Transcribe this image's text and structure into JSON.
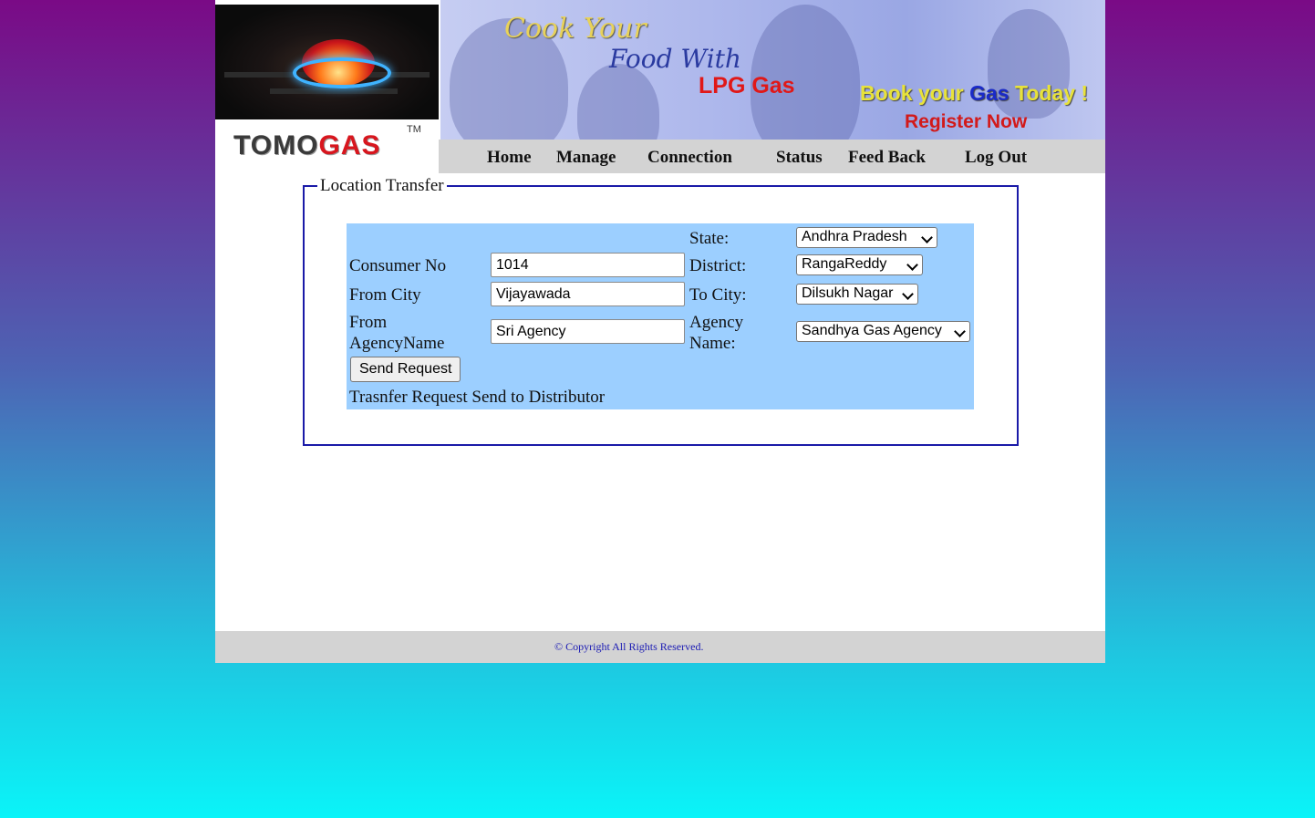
{
  "brand": {
    "logo_text_left": "TOMO",
    "logo_text_right": "GAS",
    "trademark": "TM"
  },
  "banner": {
    "line1": "Cook Your",
    "line2": "Food With",
    "line3": "LPG Gas",
    "book_part1": "Book your ",
    "book_gas": "Gas",
    "book_part2": " Today !",
    "register": "Register Now"
  },
  "nav": {
    "items": [
      {
        "label": "Home"
      },
      {
        "label": "Manage"
      },
      {
        "label": "Connection"
      },
      {
        "label": "Status"
      },
      {
        "label": "Feed Back"
      },
      {
        "label": "Log Out"
      }
    ]
  },
  "form": {
    "legend": "Location Transfer",
    "consumer_no_label": "Consumer No",
    "consumer_no_value": "1014",
    "from_city_label": "From City",
    "from_city_value": "Vijayawada",
    "from_agency_label_line1": "From",
    "from_agency_label_line2": "AgencyName",
    "from_agency_value": "Sri Agency",
    "state_label": "State:",
    "state_value": "Andhra Pradesh",
    "district_label": "District:",
    "district_value": "RangaReddy",
    "to_city_label": "To City:",
    "to_city_value": "Dilsukh Nagar",
    "agency_label_line1": "Agency",
    "agency_label_line2": "Name:",
    "agency_value": "Sandhya Gas Agency",
    "send_button": "Send Request",
    "status_message": "Trasnfer Request Send to Distributor"
  },
  "footer": {
    "copyright": "© Copyright All Rights Reserved."
  }
}
